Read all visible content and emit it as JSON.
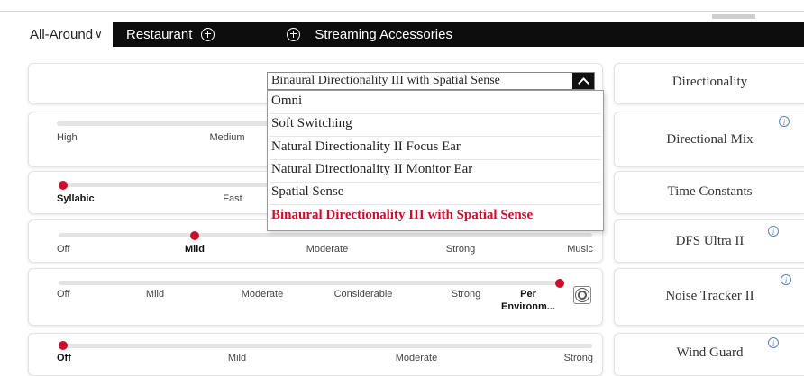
{
  "tabs": {
    "all_around": "All-Around",
    "all_around_chevron": "∨",
    "restaurant": "Restaurant",
    "streaming": "Streaming Accessories"
  },
  "directionality": {
    "label": "Directionality",
    "selected": "Binaural Directionality III with Spatial Sense",
    "options": [
      "Omni",
      "Soft Switching",
      "Natural Directionality II Focus Ear",
      "Natural Directionality II Monitor Ear",
      "Spatial Sense",
      "Binaural Directionality III with Spatial Sense"
    ]
  },
  "directional_mix": {
    "label": "Directional Mix",
    "ticks": [
      "High",
      "Medium"
    ]
  },
  "time_constants": {
    "label": "Time Constants",
    "ticks": [
      "Syllabic",
      "Fast"
    ],
    "selected": "Syllabic"
  },
  "dfs_ultra": {
    "label": "DFS Ultra II",
    "ticks": [
      "Off",
      "Mild",
      "Moderate",
      "Strong",
      "Music"
    ],
    "selected": "Mild"
  },
  "noise_tracker": {
    "label": "Noise Tracker II",
    "ticks": [
      "Off",
      "Mild",
      "Moderate",
      "Considerable",
      "Strong"
    ],
    "selected_line1": "Per",
    "selected_line2": "Environm...",
    "settings_icon": "gear-icon"
  },
  "wind_guard": {
    "label": "Wind Guard",
    "ticks": [
      "Off",
      "Mild",
      "Moderate",
      "Strong"
    ],
    "selected": "Off"
  },
  "info_glyph": "i",
  "colors": {
    "accent": "#c8102e",
    "tabbar": "#0d0d0d",
    "info": "#5a7fc0"
  }
}
